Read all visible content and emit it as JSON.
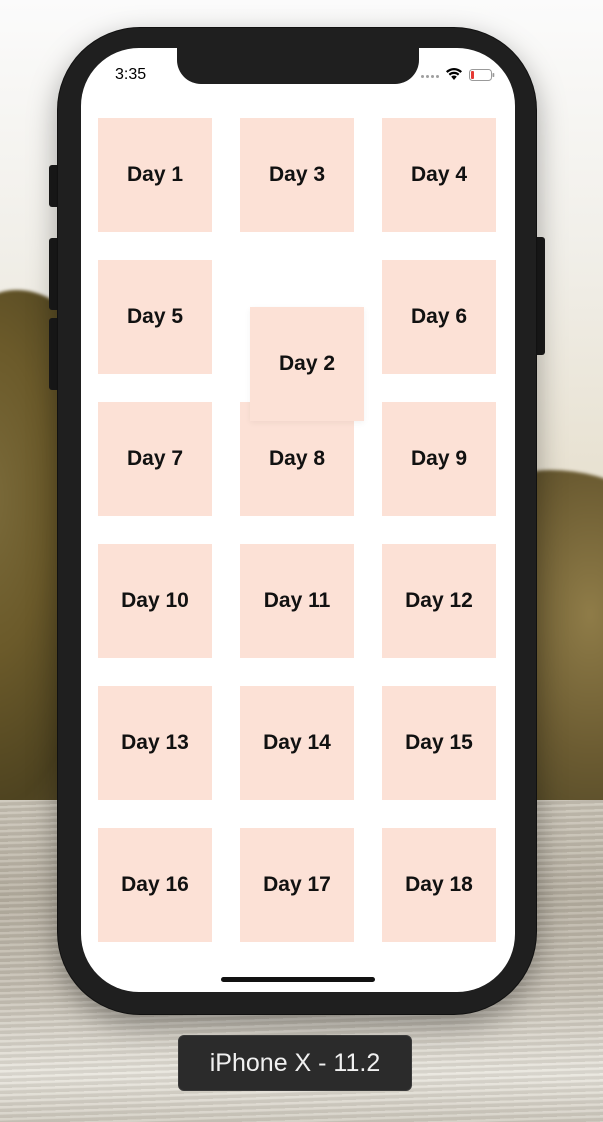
{
  "status_bar": {
    "time": "3:35",
    "icons": [
      "signal-dots-icon",
      "wifi-icon",
      "battery-low-icon"
    ],
    "battery_color": "#e53935"
  },
  "tile_color": "#fce1d6",
  "days": [
    {
      "label": "Day 1"
    },
    {
      "label": "Day 3"
    },
    {
      "label": "Day 4"
    },
    {
      "label": "Day 5"
    },
    {
      "label": "Day 6"
    },
    {
      "label": "Day 7"
    },
    {
      "label": "Day 8"
    },
    {
      "label": "Day 9"
    },
    {
      "label": "Day 10"
    },
    {
      "label": "Day 11"
    },
    {
      "label": "Day 12"
    },
    {
      "label": "Day 13"
    },
    {
      "label": "Day 14"
    },
    {
      "label": "Day 15"
    },
    {
      "label": "Day 16"
    },
    {
      "label": "Day 17"
    },
    {
      "label": "Day 18"
    }
  ],
  "dragging_tile": {
    "label": "Day 2"
  },
  "device_caption": "iPhone X - 11.2"
}
